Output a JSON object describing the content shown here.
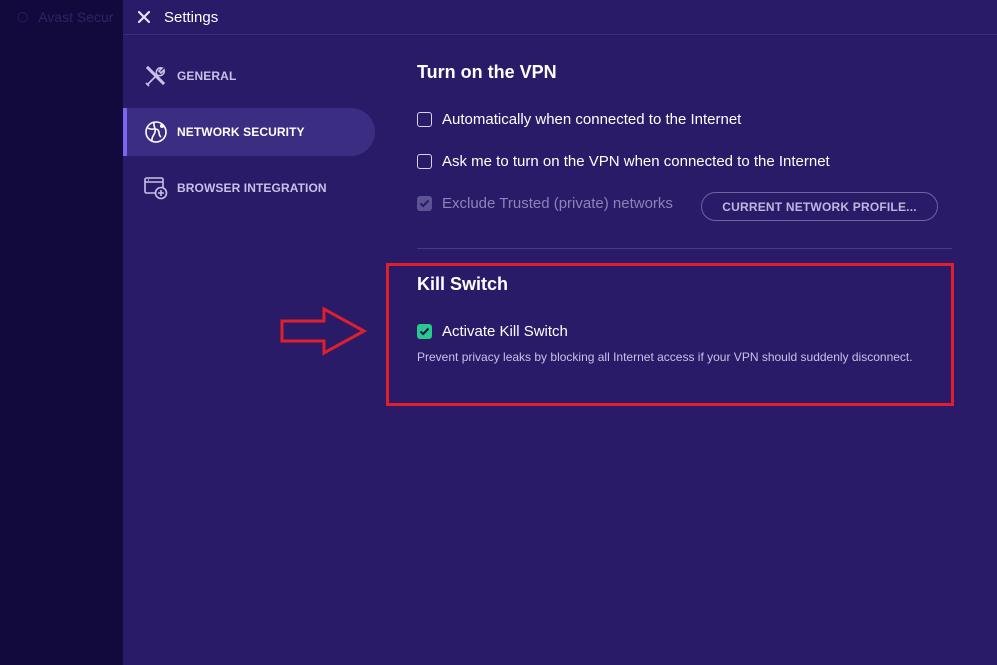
{
  "background_app": {
    "title": "Avast Secur"
  },
  "window": {
    "title": "Settings"
  },
  "sidebar": {
    "items": [
      {
        "label": "GENERAL",
        "icon": "tools-icon",
        "active": false
      },
      {
        "label": "NETWORK SECURITY",
        "icon": "globe-network-icon",
        "active": true
      },
      {
        "label": "BROWSER INTEGRATION",
        "icon": "browser-add-icon",
        "active": false
      }
    ]
  },
  "vpn": {
    "heading": "Turn on the VPN",
    "options": [
      {
        "label": "Automatically when connected to the Internet",
        "checked": false,
        "disabled": false
      },
      {
        "label": "Ask me to turn on the VPN when connected to the Internet",
        "checked": false,
        "disabled": false
      },
      {
        "label": "Exclude Trusted (private) networks",
        "checked": true,
        "disabled": true
      }
    ],
    "profile_button": "CURRENT NETWORK PROFILE..."
  },
  "kill_switch": {
    "heading": "Kill Switch",
    "option": {
      "label": "Activate Kill Switch",
      "checked": true
    },
    "description": "Prevent privacy leaks by blocking all Internet access if your VPN should suddenly disconnect."
  },
  "colors": {
    "window_bg": "#2a1b69",
    "active_item_bg": "#3b2d81",
    "accent": "#7c63f2",
    "check_green": "#29c98e",
    "annotation_red": "#e01f2d"
  }
}
